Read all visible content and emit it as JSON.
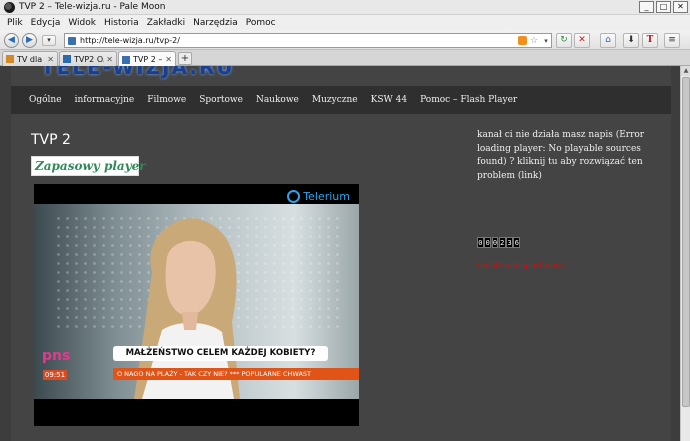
{
  "window": {
    "title": "TVP 2 – Tele-wizja.ru - Pale Moon",
    "btn_minimize": "_",
    "btn_maximize": "□",
    "btn_close": "✕"
  },
  "menu": [
    "Plik",
    "Edycja",
    "Widok",
    "Historia",
    "Zakładki",
    "Narzędzia",
    "Pomoc"
  ],
  "navbar": {
    "back": "◀",
    "forward": "▶",
    "url": "http://tele-wizja.ru/tvp-2/",
    "reload": "↻",
    "stop": "✕",
    "home": "⌂",
    "download": "⬇",
    "translate": "T",
    "menu": "≡"
  },
  "tabs": [
    {
      "label": "TV dla P...",
      "color": "#d08a2a"
    },
    {
      "label": "TVP2 O...",
      "color": "#2a6bb3"
    },
    {
      "label": "TVP 2 – ...",
      "color": "#3a6fb0"
    }
  ],
  "site": {
    "logo": "TELE-WIZJA.RU",
    "nav": [
      "Ogólne",
      "informacyjne",
      "Filmowe",
      "Sportowe",
      "Naukowe",
      "Muzyczne",
      "KSW 44",
      "Pomoc – Flash Player"
    ]
  },
  "content": {
    "title": "TVP 2",
    "backup_player": "Zapasowy player",
    "player": {
      "brand": "Telerium",
      "channel_logo": "pns",
      "time": "09:51",
      "headline": "MAŁŻEŃSTWO CELEM KAŻDEJ KOBIETY?",
      "ticker": "O NAGO NA PLAŻY - TAK CZY NIE?   ***   POPULARNE CHWAST"
    }
  },
  "sidebar": {
    "note": "kanał ci nie działa masz napis (Error loading player: No playable sources found) ? kliknij tu aby rozwiązać ten problem (link)",
    "counter": [
      "0",
      "0",
      "0",
      "2",
      "3",
      "6"
    ],
    "link": "redstreamsport.com"
  }
}
